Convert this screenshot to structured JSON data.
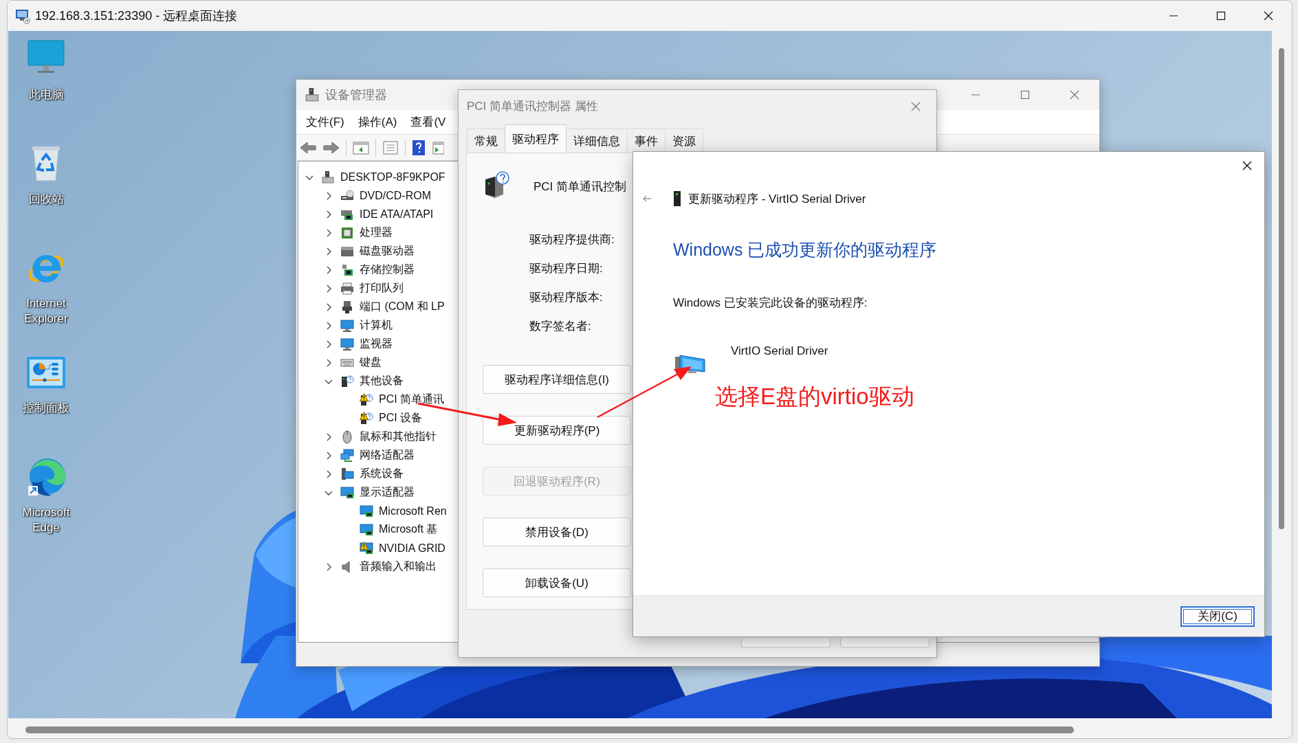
{
  "window": {
    "title": "192.168.3.151:23390 - 远程桌面连接"
  },
  "desktop_icons": [
    {
      "label": "此电脑",
      "kind": "computer"
    },
    {
      "label": "回收站",
      "kind": "recycle"
    },
    {
      "label": "Internet Explorer",
      "kind": "ie"
    },
    {
      "label": "控制面板",
      "kind": "control_panel"
    },
    {
      "label": "Microsoft Edge",
      "kind": "edge"
    }
  ],
  "device_manager": {
    "title": "设备管理器",
    "menu": [
      "文件(F)",
      "操作(A)",
      "查看(V"
    ],
    "tree": {
      "label": "DESKTOP-8F9KPOF",
      "kind": "host",
      "expanded": true,
      "children": [
        {
          "label": "DVD/CD-ROM",
          "kind": "dvd",
          "expanded": false
        },
        {
          "label": "IDE ATA/ATAPI",
          "kind": "controller",
          "expanded": false
        },
        {
          "label": "处理器",
          "kind": "cpu",
          "expanded": false
        },
        {
          "label": "磁盘驱动器",
          "kind": "disk",
          "expanded": false
        },
        {
          "label": "存储控制器",
          "kind": "storage",
          "expanded": false
        },
        {
          "label": "打印队列",
          "kind": "printer",
          "expanded": false
        },
        {
          "label": "端口 (COM 和 LP",
          "kind": "port",
          "expanded": false
        },
        {
          "label": "计算机",
          "kind": "monitor",
          "expanded": false
        },
        {
          "label": "监视器",
          "kind": "monitor",
          "expanded": false
        },
        {
          "label": "键盘",
          "kind": "keyboard",
          "expanded": false
        },
        {
          "label": "其他设备",
          "kind": "unknown",
          "expanded": true,
          "children": [
            {
              "label": "PCI 简单通讯",
              "kind": "unknown",
              "warning": true
            },
            {
              "label": "PCI 设备",
              "kind": "unknown",
              "warning": true
            }
          ]
        },
        {
          "label": "鼠标和其他指针",
          "kind": "mouse",
          "expanded": false
        },
        {
          "label": "网络适配器",
          "kind": "network",
          "expanded": false
        },
        {
          "label": "系统设备",
          "kind": "system",
          "expanded": false
        },
        {
          "label": "显示适配器",
          "kind": "display",
          "expanded": true,
          "children": [
            {
              "label": "Microsoft Ren",
              "kind": "display",
              "warning": false
            },
            {
              "label": "Microsoft 基",
              "kind": "display",
              "warning": false
            },
            {
              "label": "NVIDIA GRID",
              "kind": "display",
              "warning": true
            }
          ]
        },
        {
          "label": "音频输入和输出",
          "kind": "audio",
          "expanded": false
        }
      ]
    }
  },
  "properties": {
    "title": "PCI 简单通讯控制器 属性",
    "tabs": [
      {
        "label": "常规",
        "selected": false
      },
      {
        "label": "驱动程序",
        "selected": true
      },
      {
        "label": "详细信息",
        "selected": false
      },
      {
        "label": "事件",
        "selected": false
      },
      {
        "label": "资源",
        "selected": false
      }
    ],
    "device_name": "PCI 简单通讯控制",
    "fields": [
      "驱动程序提供商:",
      "驱动程序日期:",
      "驱动程序版本:",
      "数字签名者:"
    ],
    "buttons": [
      {
        "label": "驱动程序详细信息(I)",
        "disabled": false
      },
      {
        "label": "更新驱动程序(P)",
        "disabled": false
      },
      {
        "label": "回退驱动程序(R)",
        "disabled": true
      },
      {
        "label": "禁用设备(D)",
        "disabled": false
      },
      {
        "label": "卸载设备(U)",
        "disabled": false
      }
    ]
  },
  "update_dialog": {
    "title": "更新驱动程序 - VirtIO Serial Driver",
    "heading": "Windows 已成功更新你的驱动程序",
    "message": "Windows 已安装完此设备的驱动程序:",
    "driver_name": "VirtIO Serial Driver",
    "close_button": "关闭(C)"
  },
  "annotation": {
    "text": "选择E盘的virtio驱动"
  }
}
